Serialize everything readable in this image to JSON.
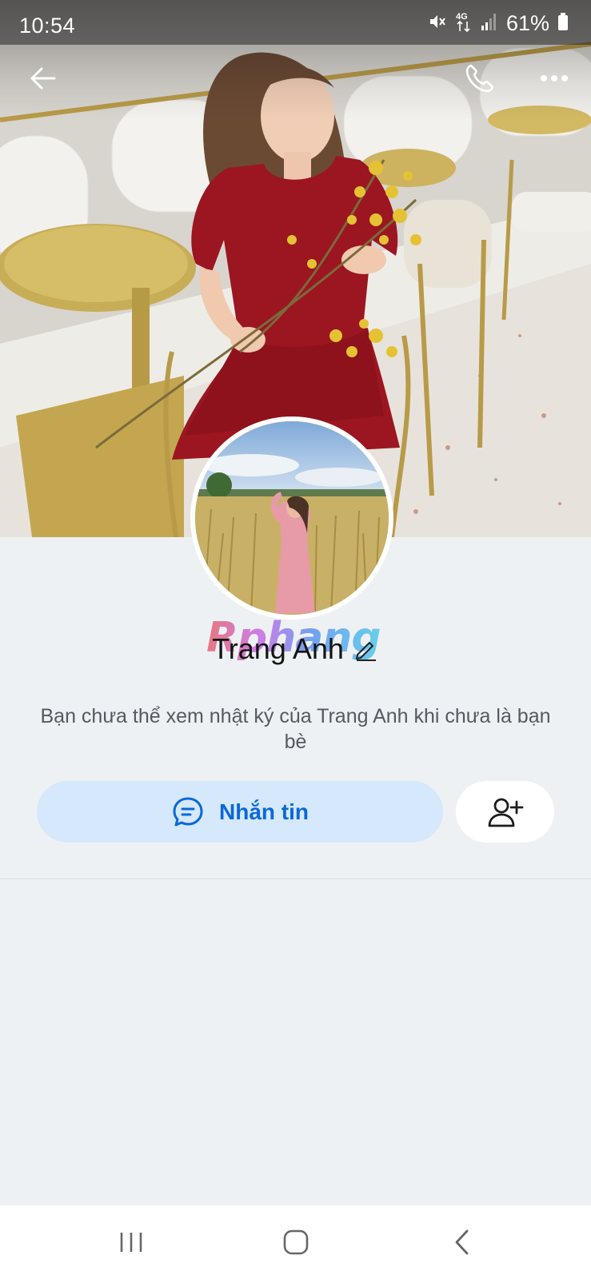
{
  "status_bar": {
    "time": "10:54",
    "battery_percent": "61%",
    "icons": [
      "mute-icon",
      "4g-icon",
      "signal-icon",
      "battery-icon"
    ]
  },
  "top_bar": {
    "icons": [
      "back-arrow-icon",
      "phone-icon",
      "more-icon"
    ]
  },
  "profile": {
    "name": "Trang Anh",
    "watermark": "Rphang",
    "info_message": "Bạn chưa thể xem nhật ký của Trang Anh khi chưa là bạn bè"
  },
  "actions": {
    "message_label": "Nhắn tin",
    "message_icon": "chat-bubble-icon",
    "add_friend_icon": "add-friend-icon"
  },
  "nav_bar": {
    "icons": [
      "recents-icon",
      "home-icon",
      "back-icon"
    ]
  },
  "colors": {
    "accent": "#0a68d8",
    "message_button_bg": "#d6e8fb",
    "page_bg": "#eef1f3"
  }
}
